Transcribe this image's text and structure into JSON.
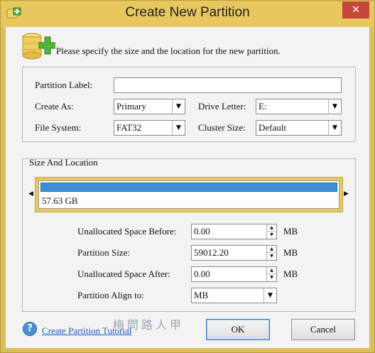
{
  "window": {
    "title": "Create New Partition",
    "close_glyph": "✕",
    "accent_color": "#e8c85e"
  },
  "instruction": "Please specify the size and the location for the new partition.",
  "general": {
    "partition_label": {
      "label": "Partition Label:",
      "value": ""
    },
    "create_as": {
      "label": "Create As:",
      "value": "Primary"
    },
    "drive_letter": {
      "label": "Drive Letter:",
      "value": "E:"
    },
    "file_system": {
      "label": "File System:",
      "value": "FAT32"
    },
    "cluster_size": {
      "label": "Cluster Size:",
      "value": "Default"
    }
  },
  "size_location": {
    "title": "Size And Location",
    "partition_display_size": "57.63 GB",
    "partition_bar_color": "#3a8fd6",
    "unallocated_before": {
      "label": "Unallocated Space Before:",
      "value": "0.00",
      "unit": "MB"
    },
    "partition_size": {
      "label": "Partition Size:",
      "value": "59012.20",
      "unit": "MB"
    },
    "unallocated_after": {
      "label": "Unallocated Space After:",
      "value": "0.00",
      "unit": "MB"
    },
    "align_to": {
      "label": "Partition Align to:",
      "value": "MB"
    }
  },
  "footer": {
    "help_glyph": "?",
    "help_link": "Create Partition Tutorial",
    "watermark": "梅問路人甲",
    "ok_label": "OK",
    "cancel_label": "Cancel"
  },
  "icons": {
    "title": "add-partition-icon",
    "header": "disk-add-icon",
    "help": "help-icon",
    "dropdown": "chevron-down-icon",
    "spin": "spin-arrows-icon"
  }
}
